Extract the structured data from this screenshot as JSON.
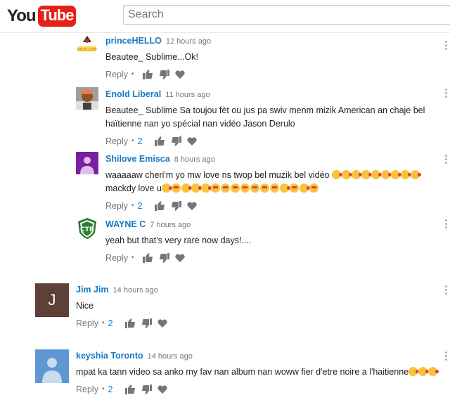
{
  "header": {
    "logo_you": "You",
    "logo_tube": "Tube",
    "search_placeholder": "Search"
  },
  "comments": [
    {
      "author": "princeHELLO",
      "time": "12 hours ago",
      "text": "Beautee_ Sublime...Ok!",
      "reply_label": "Reply",
      "reply_count": "",
      "avatar": "prince-badge-avatar"
    },
    {
      "author": "Enold Liberal",
      "time": "11 hours ago",
      "text": "Beautee_ Sublime Sa toujou fèt ou jus pa swiv menm mizik American an chaje bel haïtienne nan yo spécial nan vidéo Jason Derulo",
      "reply_label": "Reply",
      "reply_count": "2",
      "avatar": "photo-avatar"
    },
    {
      "author": "Shilove Emisca",
      "time": "8 hours ago",
      "text": "waaaaaw cheri'm yo mw love ns twop bel muzik bel vidéo",
      "text2": "mackdy love u",
      "reply_label": "Reply",
      "reply_count": "2",
      "avatar": "default-purple-avatar"
    },
    {
      "author": "WAYNE C",
      "time": "7 hours ago",
      "text": "yeah but that's very rare now days!....",
      "reply_label": "Reply",
      "reply_count": "",
      "avatar": "ctr-shield-avatar"
    },
    {
      "author": "Jim Jim",
      "time": "14 hours ago",
      "text": "Nice",
      "reply_label": "Reply",
      "reply_count": "2",
      "avatar_letter": "J",
      "avatar_color": "#5d4037"
    },
    {
      "author": "keyshia Toronto",
      "time": "14 hours ago",
      "text": "mpat ka tann video sa anko my fav nan album nan woww fier d'etre noire a l'haitienne",
      "reply_label": "Reply",
      "reply_count": "2",
      "avatar": "default-blue-avatar"
    }
  ]
}
